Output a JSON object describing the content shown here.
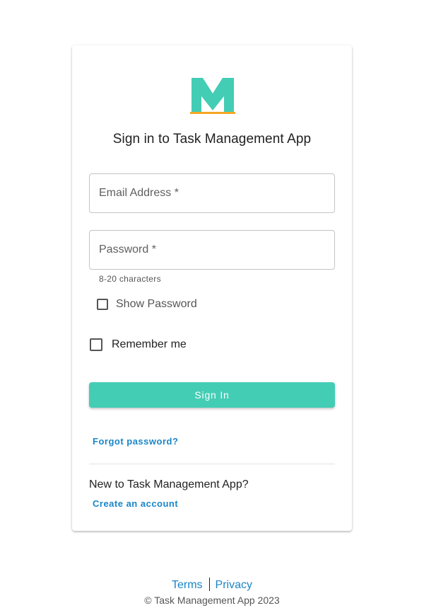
{
  "app": {
    "title": "Sign in to Task Management App",
    "brand_color": "#44cdb5",
    "accent_color": "#f5a623",
    "logo_icon": "m-logo-icon"
  },
  "form": {
    "email_placeholder": "Email Address *",
    "password_placeholder": "Password *",
    "password_helper": "8-20 characters",
    "show_password_label": "Show Password",
    "remember_label": "Remember me",
    "submit_label": "Sign In",
    "forgot_label": "Forgot password?"
  },
  "signup": {
    "prompt": "New to Task Management App?",
    "link_label": "Create an account"
  },
  "footer": {
    "terms": "Terms",
    "privacy": "Privacy",
    "copyright": "© Task Management App 2023"
  }
}
